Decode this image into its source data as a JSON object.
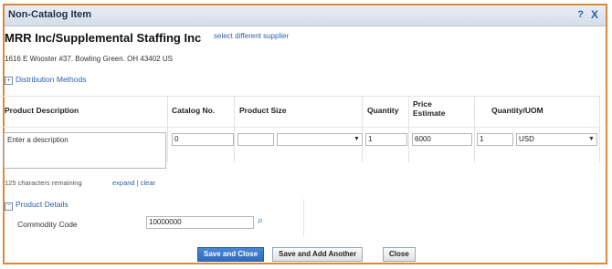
{
  "dialog": {
    "title": "Non-Catalog Item",
    "help_label": "?",
    "close_label": "X"
  },
  "supplier": {
    "name": "MRR Inc/Supplemental Staffing Inc",
    "select_link": "select different supplier",
    "address": "1616 E Wooster #37. Bowling Green. OH 43402 US"
  },
  "distribution": {
    "label": "Distribution Methods",
    "toggle": "+"
  },
  "table": {
    "headers": {
      "desc": "Product Description",
      "catalog": "Catalog No.",
      "size": "Product Size",
      "quantity": "Quantity",
      "price_line1": "Price",
      "price_line2": "Estimate",
      "uom": "Quantity/UOM"
    },
    "row": {
      "description_placeholder": "Enter a description",
      "catalog_value": "0",
      "size_value": "",
      "size_option": "",
      "quantity_value": "1",
      "price_value": "6000",
      "uom_qty": "1",
      "uom_unit": "USD"
    }
  },
  "desc_footer": {
    "remaining": "125 characters remaining",
    "expand": "expand",
    "sep": "|",
    "clear": "clear"
  },
  "product_details": {
    "label": "Product Details",
    "toggle": "−"
  },
  "commodity": {
    "label": "Commodity Code",
    "value": "10000000"
  },
  "buttons": {
    "save_close": "Save and Close",
    "save_add": "Save and Add Another",
    "close": "Close"
  },
  "colors": {
    "border": "#d98a3a",
    "link": "#2d5fa8",
    "primary": "#2f6cc0"
  }
}
